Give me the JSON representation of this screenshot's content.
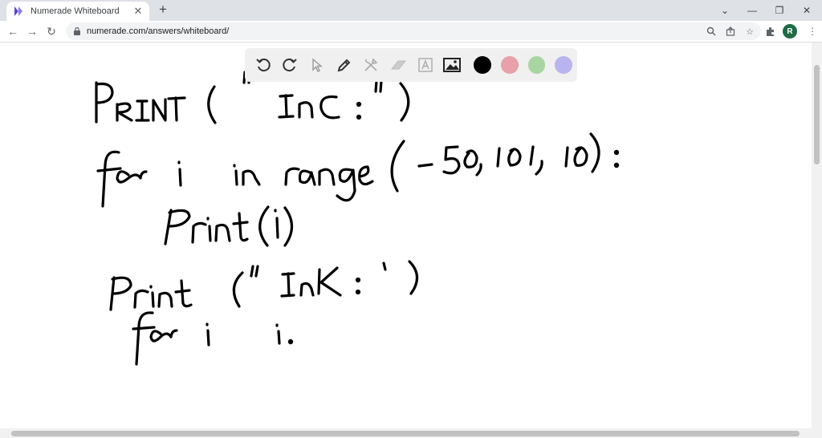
{
  "browser": {
    "tab_title": "Numerade Whiteboard",
    "url": "numerade.com/answers/whiteboard/",
    "profile_initial": "R",
    "profile_color": "#1e6b45"
  },
  "whiteboard": {
    "tools": [
      "undo-icon",
      "redo-icon",
      "pointer-icon",
      "pen-icon",
      "tools-icon",
      "eraser-icon",
      "text-icon",
      "image-icon"
    ],
    "colors": [
      "#000000",
      "#e8a1a8",
      "#a8d5a2",
      "#b9b3f0"
    ],
    "selected_color": "#000000",
    "handwriting_lines": [
      "PRINT ( \"InC: \")",
      "for i in range ( -50, 101, 10) :",
      "Print (i)",
      "Print (\"InK: \")",
      "for i i."
    ]
  }
}
